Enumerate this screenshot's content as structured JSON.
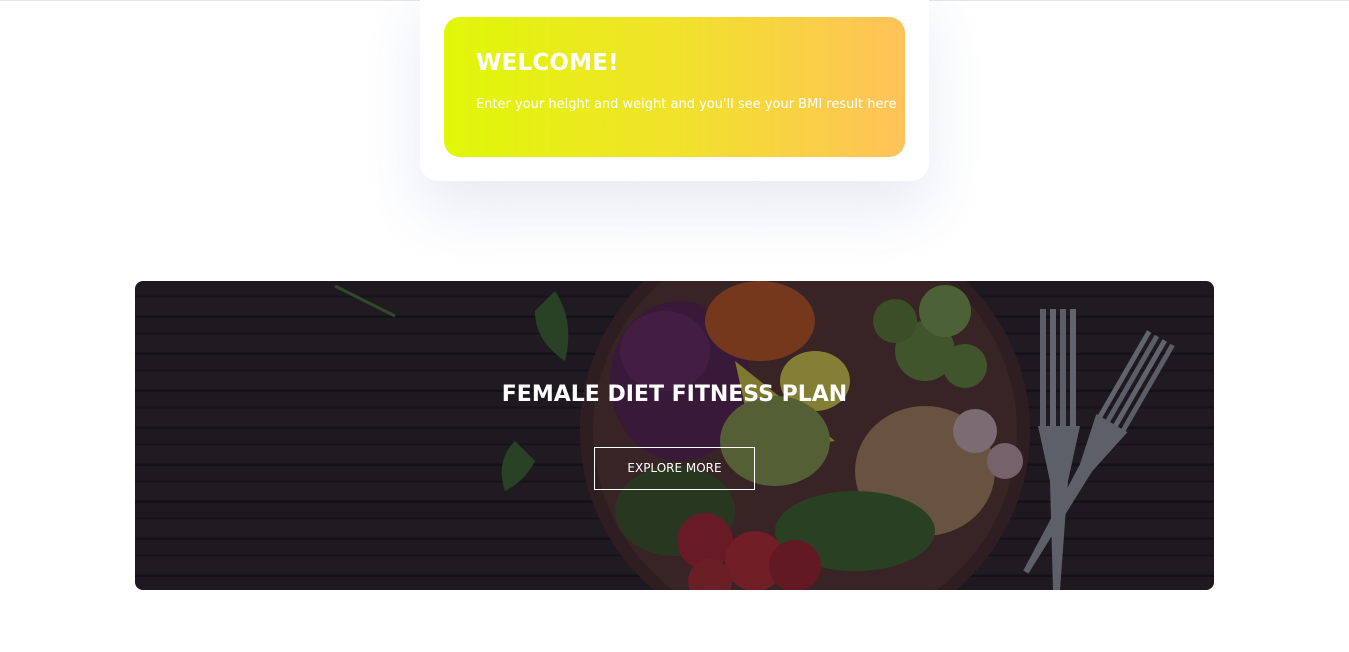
{
  "bmi_result": {
    "title": "WELCOME!",
    "message": "Enter your height and weight and you'll see your BMI result here",
    "gradient_colors": [
      "#e0f707",
      "#f1e22b",
      "#ffc25a"
    ]
  },
  "diet_banner": {
    "title": "FEMALE DIET FITNESS PLAN",
    "button_label": "EXPLORE MORE",
    "image_description_icon": "salad-bowl-image"
  }
}
